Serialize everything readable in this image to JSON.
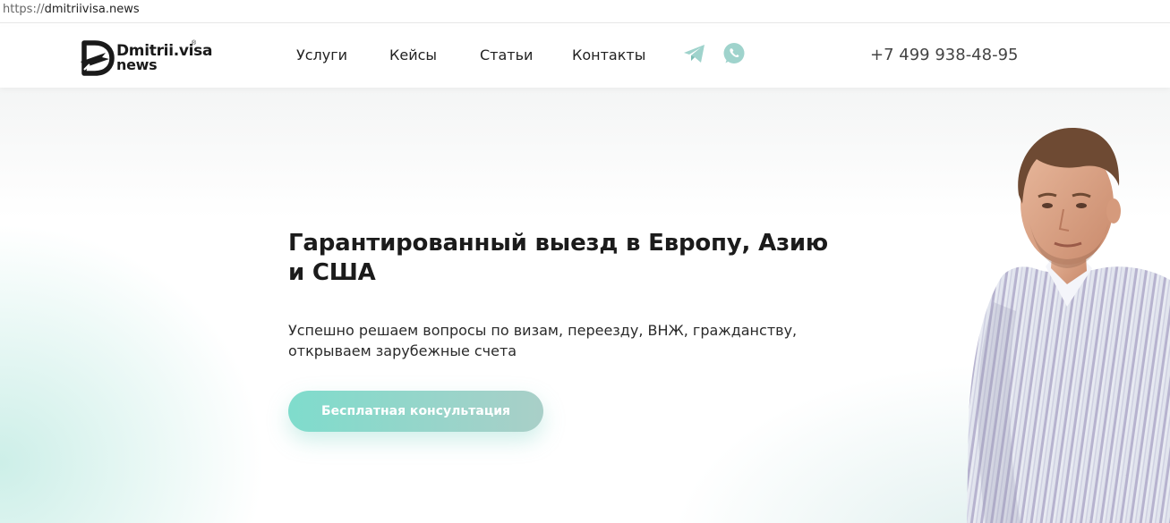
{
  "browser": {
    "url_scheme": "https://",
    "url_host": "dmitriivisa.news"
  },
  "header": {
    "logo": {
      "line1": "Dmitrii.visa",
      "line2": "news",
      "reg_mark": "®"
    },
    "nav": [
      {
        "label": "Услуги"
      },
      {
        "label": "Кейсы"
      },
      {
        "label": "Статьи"
      },
      {
        "label": "Контакты"
      }
    ],
    "social": [
      {
        "icon": "telegram-icon"
      },
      {
        "icon": "whatsapp-icon"
      }
    ],
    "phone": "+7 499 938-48-95"
  },
  "hero": {
    "title": "Гарантированный выезд в Европу, Азию и США",
    "subtitle": "Успешно решаем вопросы по визам, переезду, ВНЖ, гражданству, открываем зарубежные счета",
    "cta_label": "Бесплатная консультация"
  },
  "colors": {
    "accent": "#7fdccc",
    "accent_end": "#a9cfc8",
    "icon_tint": "#9fd3cc",
    "text_dark": "#1b1b1b"
  }
}
